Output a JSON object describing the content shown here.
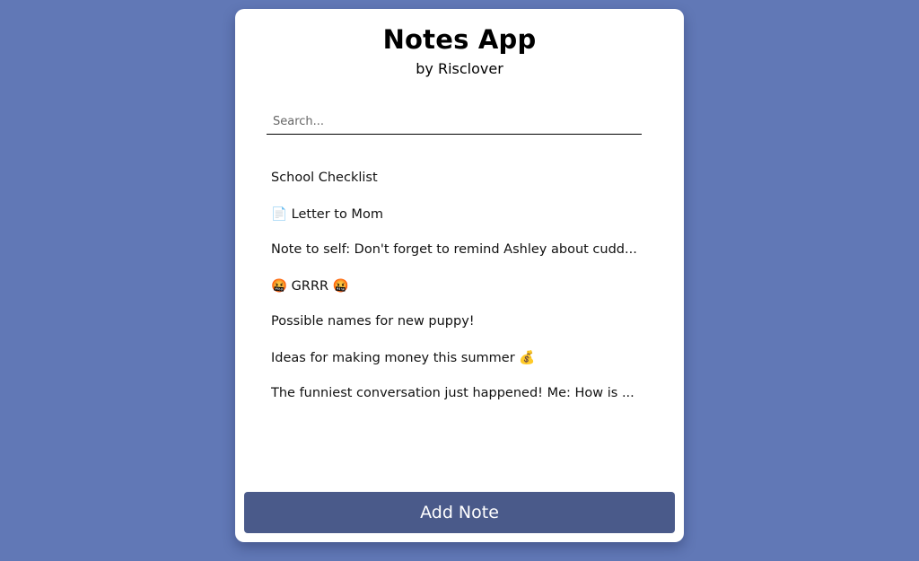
{
  "app": {
    "title": "Notes App",
    "subtitle": "by Risclover"
  },
  "search": {
    "placeholder": "Search...",
    "value": ""
  },
  "notes": [
    {
      "title": "School Checklist"
    },
    {
      "title": "📄 Letter to Mom"
    },
    {
      "title": "Note to self: Don't forget to remind Ashley about cudd..."
    },
    {
      "title": "🤬 GRRR 🤬"
    },
    {
      "title": "Possible names for new puppy!"
    },
    {
      "title": "Ideas for making money this summer 💰"
    },
    {
      "title": "The funniest conversation just happened! Me: How is ..."
    }
  ],
  "actions": {
    "add_note_label": "Add Note"
  },
  "colors": {
    "background": "#6178b6",
    "card": "#ffffff",
    "button": "#4a5a8a"
  }
}
